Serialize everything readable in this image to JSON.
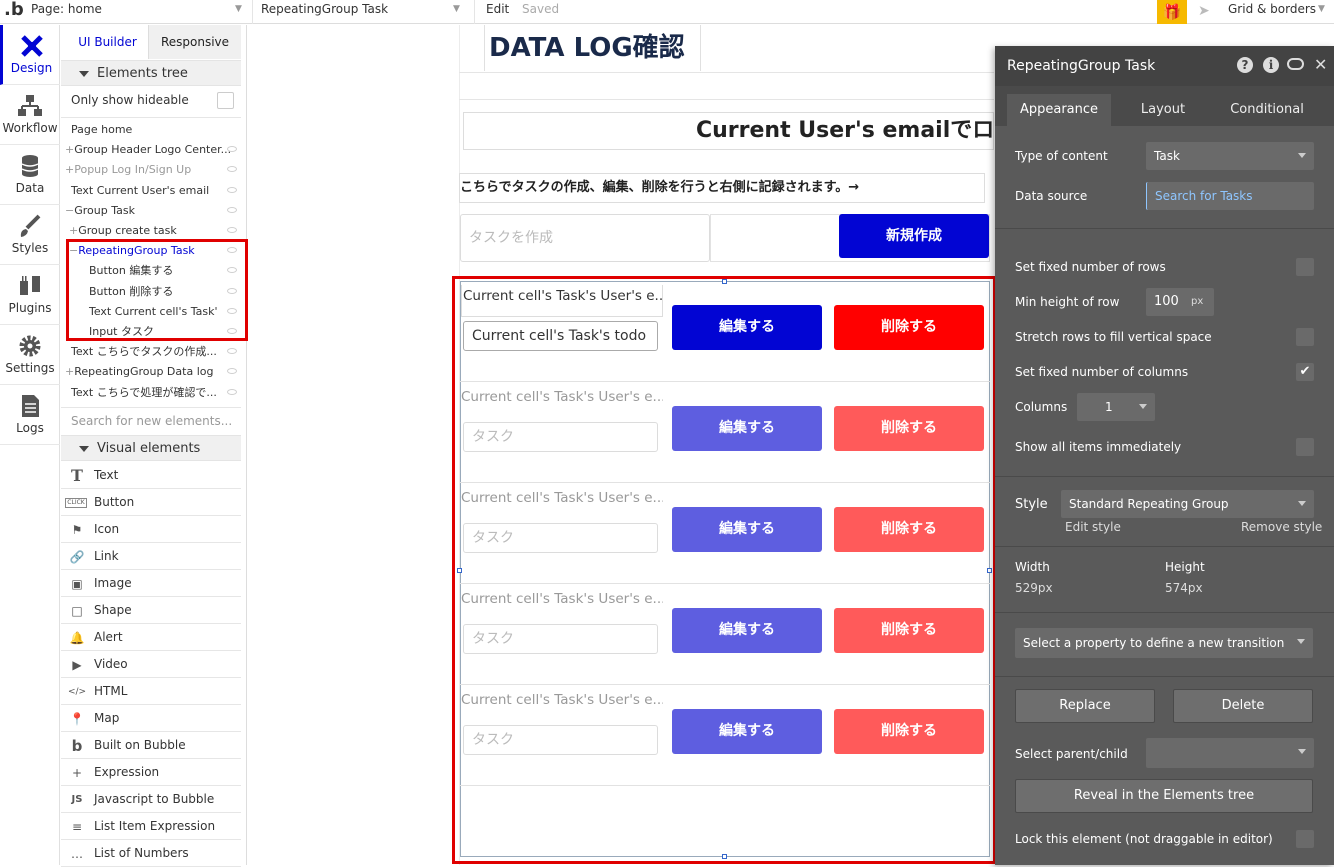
{
  "topbar": {
    "logo": ".b",
    "page_label": "Page: home",
    "element_label": "RepeatingGroup Task",
    "edit_label": "Edit",
    "saved_label": "Saved",
    "grid_label": "Grid & borders"
  },
  "leftnav": {
    "items": [
      {
        "label": "Design",
        "icon": "design-icon"
      },
      {
        "label": "Workflow",
        "icon": "workflow-icon"
      },
      {
        "label": "Data",
        "icon": "data-icon"
      },
      {
        "label": "Styles",
        "icon": "styles-icon"
      },
      {
        "label": "Plugins",
        "icon": "plugins-icon"
      },
      {
        "label": "Settings",
        "icon": "settings-icon"
      },
      {
        "label": "Logs",
        "icon": "logs-icon"
      }
    ]
  },
  "panel": {
    "tabs": [
      "UI Builder",
      "Responsive"
    ],
    "elements_tree_title": "Elements tree",
    "only_hideable": "Only show hideable",
    "tree": [
      {
        "label": "Page home",
        "indent": 0,
        "prefix": ""
      },
      {
        "label": "Group Header Logo Center...",
        "indent": 0,
        "prefix": "+"
      },
      {
        "label": "Popup Log In/Sign Up",
        "indent": 0,
        "prefix": "+"
      },
      {
        "label": "Text Current User's email",
        "indent": 0,
        "prefix": ""
      },
      {
        "label": "Group Task",
        "indent": 0,
        "prefix": "−"
      },
      {
        "label": "Group create task",
        "indent": 1,
        "prefix": "+"
      },
      {
        "label": "RepeatingGroup Task",
        "indent": 1,
        "prefix": "−"
      },
      {
        "label": "Button 編集する",
        "indent": 2,
        "prefix": ""
      },
      {
        "label": "Button 削除する",
        "indent": 2,
        "prefix": ""
      },
      {
        "label": "Text Current cell's Task'",
        "indent": 2,
        "prefix": ""
      },
      {
        "label": "Input タスク",
        "indent": 2,
        "prefix": ""
      },
      {
        "label": "Text こちらでタスクの作成...",
        "indent": 0,
        "prefix": ""
      },
      {
        "label": "RepeatingGroup Data log",
        "indent": 0,
        "prefix": "+"
      },
      {
        "label": "Text こちらで処理が確認で...",
        "indent": 0,
        "prefix": ""
      }
    ],
    "search_placeholder": "Search for new elements...",
    "visual_elements_title": "Visual elements",
    "visual_elements": [
      {
        "label": "Text",
        "icon": "T"
      },
      {
        "label": "Button",
        "icon": "CLICK"
      },
      {
        "label": "Icon",
        "icon": "⚑"
      },
      {
        "label": "Link",
        "icon": "🔗"
      },
      {
        "label": "Image",
        "icon": "▣"
      },
      {
        "label": "Shape",
        "icon": "□"
      },
      {
        "label": "Alert",
        "icon": "🔔"
      },
      {
        "label": "Video",
        "icon": "▶"
      },
      {
        "label": "HTML",
        "icon": "</>"
      },
      {
        "label": "Map",
        "icon": "📍"
      },
      {
        "label": "Built on Bubble",
        "icon": "b"
      },
      {
        "label": "Expression",
        "icon": "+"
      },
      {
        "label": "Javascript to Bubble",
        "icon": "JS"
      },
      {
        "label": "List Item Expression",
        "icon": "≡"
      },
      {
        "label": "List of Numbers",
        "icon": "…"
      }
    ]
  },
  "canvas": {
    "title": "DATA LOG確認",
    "email_text": "Current User's emailでログ",
    "instruction": "こちらでタスクの作成、編集、削除を行うと右側に記録されます。→",
    "create_placeholder": "タスクを作成",
    "create_button": "新規作成",
    "rows": [
      {
        "user_text": "Current cell's Task's User's e...",
        "input_value": "Current cell's Task's todo",
        "edit": "編集する",
        "delete": "削除する",
        "active": true
      },
      {
        "user_text": "Current cell's Task's User's e...",
        "input_value": "タスク",
        "edit": "編集する",
        "delete": "削除する",
        "active": false
      },
      {
        "user_text": "Current cell's Task's User's e...",
        "input_value": "タスク",
        "edit": "編集する",
        "delete": "削除する",
        "active": false
      },
      {
        "user_text": "Current cell's Task's User's e...",
        "input_value": "タスク",
        "edit": "編集する",
        "delete": "削除する",
        "active": false
      },
      {
        "user_text": "Current cell's Task's User's e...",
        "input_value": "タスク",
        "edit": "編集する",
        "delete": "削除する",
        "active": false
      }
    ]
  },
  "property_editor": {
    "title": "RepeatingGroup Task",
    "tabs": [
      "Appearance",
      "Layout",
      "Conditional"
    ],
    "type_of_content_label": "Type of content",
    "type_of_content_value": "Task",
    "data_source_label": "Data source",
    "data_source_value": "Search for Tasks",
    "fixed_rows_label": "Set fixed number of rows",
    "min_height_label": "Min height of row",
    "min_height_value": "100",
    "min_height_unit": "px",
    "stretch_label": "Stretch rows to fill vertical space",
    "fixed_columns_label": "Set fixed number of columns",
    "columns_label": "Columns",
    "columns_value": "1",
    "show_all_label": "Show all items immediately",
    "style_label": "Style",
    "style_value": "Standard Repeating Group",
    "edit_style": "Edit style",
    "remove_style": "Remove style",
    "width_label": "Width",
    "width_value": "529px",
    "height_label": "Height",
    "height_value": "574px",
    "transition_placeholder": "Select a property to define a new transition",
    "replace_button": "Replace",
    "delete_button": "Delete",
    "parent_child_label": "Select parent/child",
    "reveal_button": "Reveal in the Elements tree",
    "lock_label": "Lock this element (not draggable in editor)"
  },
  "colors": {
    "accent": "#0205d3",
    "highlight": "#e00000",
    "delete": "#ff0000",
    "delete_light": "#ff5a5a",
    "edit_light": "#5e5ee0",
    "gift": "#f6b900"
  }
}
